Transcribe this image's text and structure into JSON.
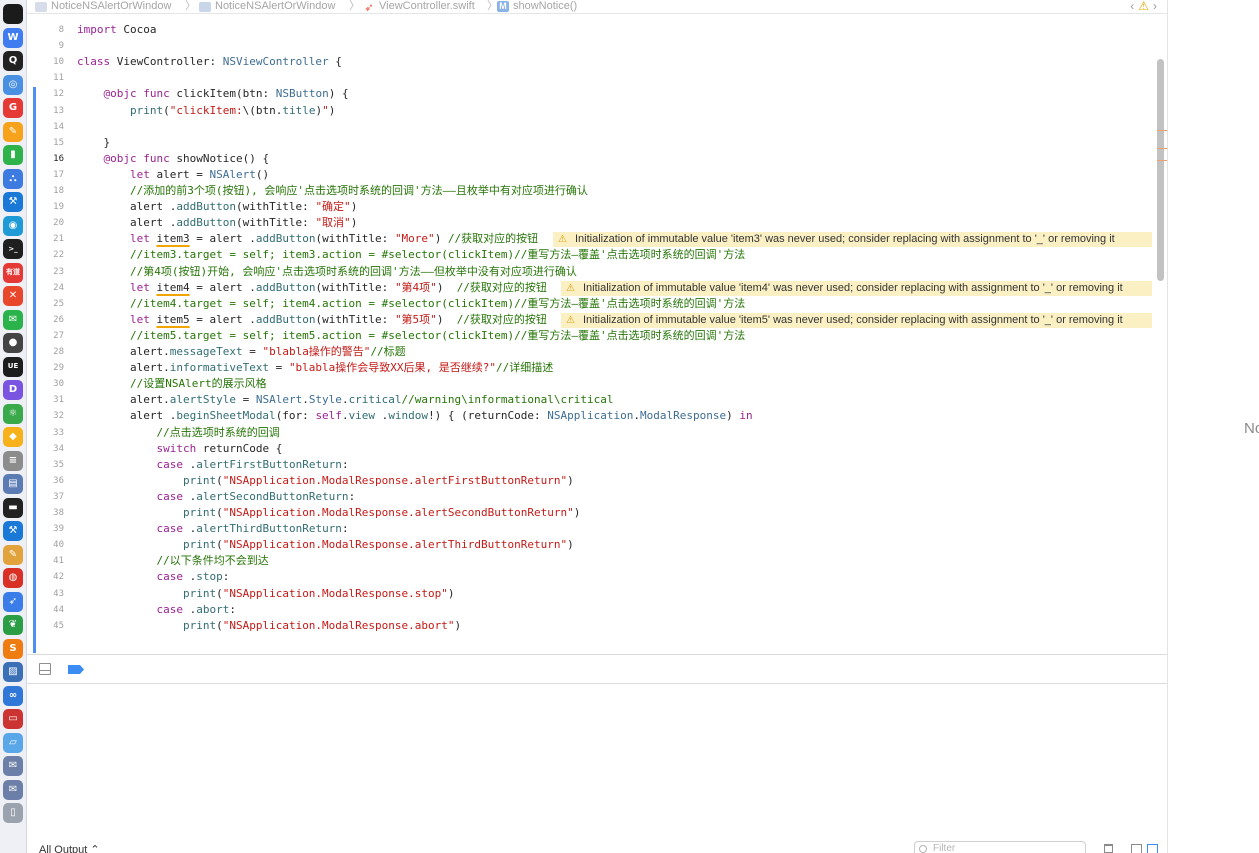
{
  "jumpbar": {
    "crumbs": [
      "NoticeNSAlertOrWindow",
      "NoticeNSAlertOrWindow",
      "ViewController.swift",
      "showNotice()"
    ],
    "separator": "〉",
    "nav_back": "‹",
    "nav_forward": "›",
    "warning_nav": "⚠"
  },
  "dock": [
    {
      "name": "qq-icon",
      "glyph": "",
      "color": "#1b1b1b"
    },
    {
      "name": "wps-icon",
      "glyph": "W",
      "color": "#3f7cf0"
    },
    {
      "name": "penguin-icon",
      "glyph": "Q",
      "color": "#222222"
    },
    {
      "name": "browser-icon",
      "glyph": "◎",
      "color": "#4a90e2"
    },
    {
      "name": "google-icon",
      "glyph": "G",
      "color": "#e53935"
    },
    {
      "name": "quill-icon",
      "glyph": "✎",
      "color": "#f7a21b"
    },
    {
      "name": "numbers-icon",
      "glyph": "▮",
      "color": "#2db34a"
    },
    {
      "name": "keynote-icon",
      "glyph": "⛬",
      "color": "#3e7be0"
    },
    {
      "name": "xcode-icon",
      "glyph": "⚒",
      "color": "#1a78d6"
    },
    {
      "name": "instruments-icon",
      "glyph": "◉",
      "color": "#1e9bd7"
    },
    {
      "name": "terminal-icon",
      "glyph": ">_",
      "color": "#1f1f1f"
    },
    {
      "name": "youdao-icon",
      "glyph": "有道",
      "color": "#e53935"
    },
    {
      "name": "xmind-icon",
      "glyph": "✕",
      "color": "#e8472b"
    },
    {
      "name": "wechat-icon",
      "glyph": "✉",
      "color": "#2bb34b"
    },
    {
      "name": "capture-icon",
      "glyph": "●",
      "color": "#444444"
    },
    {
      "name": "ue-icon",
      "glyph": "UE",
      "color": "#1d1d1d"
    },
    {
      "name": "dash-icon",
      "glyph": "D",
      "color": "#7a54e0"
    },
    {
      "name": "atom-icon",
      "glyph": "⚛",
      "color": "#3aa94a"
    },
    {
      "name": "sketch-icon",
      "glyph": "◆",
      "color": "#f7b21b"
    },
    {
      "name": "database-icon",
      "glyph": "≡",
      "color": "#8c8c8c"
    },
    {
      "name": "preview-icon",
      "glyph": "▤",
      "color": "#5b7bb5"
    },
    {
      "name": "activity-icon",
      "glyph": "▬",
      "color": "#222222"
    },
    {
      "name": "xcode2-icon",
      "glyph": "⚒",
      "color": "#1a78d6"
    },
    {
      "name": "notes-icon",
      "glyph": "✎",
      "color": "#e2a23c"
    },
    {
      "name": "chrome-icon",
      "glyph": "◍",
      "color": "#d93025"
    },
    {
      "name": "bird-icon",
      "glyph": "➶",
      "color": "#3b7de8"
    },
    {
      "name": "evernote-icon",
      "glyph": "❦",
      "color": "#2a9d45"
    },
    {
      "name": "sublime-icon",
      "glyph": "S",
      "color": "#ef7c10"
    },
    {
      "name": "gallery-icon",
      "glyph": "▨",
      "color": "#3b6fb6"
    },
    {
      "name": "network-icon",
      "glyph": "∞",
      "color": "#2f78d8"
    },
    {
      "name": "screen-icon",
      "glyph": "▭",
      "color": "#cc3333"
    },
    {
      "name": "finder-icon",
      "glyph": "▱",
      "color": "#59a6e9"
    },
    {
      "name": "mail-icon",
      "glyph": "✉",
      "color": "#6b7fa8"
    },
    {
      "name": "mail2-icon",
      "glyph": "✉",
      "color": "#6b7fa8"
    },
    {
      "name": "trash-dock-icon",
      "glyph": "▯",
      "color": "#9aa3ad"
    }
  ],
  "code": [
    {
      "n": "8",
      "t": [
        [
          "kw",
          "import"
        ],
        [
          "pl",
          " Cocoa"
        ]
      ]
    },
    {
      "n": "9",
      "t": []
    },
    {
      "n": "10",
      "t": [
        [
          "kw",
          "class"
        ],
        [
          "pl",
          " ViewController: "
        ],
        [
          "ty",
          "NSViewController"
        ],
        [
          "pl",
          " {"
        ]
      ]
    },
    {
      "n": "11",
      "t": []
    },
    {
      "n": "12",
      "t": [
        [
          "pl",
          "    "
        ],
        [
          "kw",
          "@objc"
        ],
        [
          "pl",
          " "
        ],
        [
          "kw",
          "func"
        ],
        [
          "pl",
          " clickItem(btn: "
        ],
        [
          "ty",
          "NSButton"
        ],
        [
          "pl",
          ") {"
        ]
      ]
    },
    {
      "n": "13",
      "t": [
        [
          "pl",
          "        "
        ],
        [
          "fn",
          "print"
        ],
        [
          "pl",
          "("
        ],
        [
          "str",
          "\"clickItem:"
        ],
        [
          "pl",
          "\\(btn."
        ],
        [
          "fn",
          "title"
        ],
        [
          "pl",
          ")"
        ],
        [
          "str",
          "\""
        ],
        [
          "pl",
          ")"
        ]
      ]
    },
    {
      "n": "14",
      "t": []
    },
    {
      "n": "15",
      "t": [
        [
          "pl",
          "    }"
        ]
      ]
    },
    {
      "n": "16",
      "cur": true,
      "t": [
        [
          "pl",
          "    "
        ],
        [
          "kw",
          "@objc"
        ],
        [
          "pl",
          " "
        ],
        [
          "kw",
          "func"
        ],
        [
          "pl",
          " showNotice() {"
        ]
      ]
    },
    {
      "n": "17",
      "t": [
        [
          "pl",
          "        "
        ],
        [
          "kw",
          "let"
        ],
        [
          "pl",
          " alert = "
        ],
        [
          "ty",
          "NSAlert"
        ],
        [
          "pl",
          "()"
        ]
      ]
    },
    {
      "n": "18",
      "t": [
        [
          "pl",
          "        "
        ],
        [
          "cm",
          "//添加的前3个项(按钮), 会响应'点击选项时系统的回调'方法——且枚举中有对应项进行确认"
        ]
      ]
    },
    {
      "n": "19",
      "t": [
        [
          "pl",
          "        alert ."
        ],
        [
          "fn",
          "addButton"
        ],
        [
          "pl",
          "(withTitle: "
        ],
        [
          "str",
          "\"确定\""
        ],
        [
          "pl",
          ")"
        ]
      ]
    },
    {
      "n": "20",
      "t": [
        [
          "pl",
          "        alert ."
        ],
        [
          "fn",
          "addButton"
        ],
        [
          "pl",
          "(withTitle: "
        ],
        [
          "str",
          "\"取消\""
        ],
        [
          "pl",
          ")"
        ]
      ]
    },
    {
      "n": "21",
      "warn": "Initialization of immutable value 'item3' was never used; consider replacing with assignment to '_' or removing it",
      "wl": 526,
      "t": [
        [
          "pl",
          "        "
        ],
        [
          "kw",
          "let"
        ],
        [
          "pl",
          " "
        ],
        [
          "wu",
          "item3"
        ],
        [
          "pl",
          " = alert ."
        ],
        [
          "fn",
          "addButton"
        ],
        [
          "pl",
          "(withTitle: "
        ],
        [
          "str",
          "\"More\""
        ],
        [
          "pl",
          ") "
        ],
        [
          "cm",
          "//获取对应的按钮"
        ]
      ]
    },
    {
      "n": "22",
      "t": [
        [
          "pl",
          "        "
        ],
        [
          "cm",
          "//item3.target = self; item3.action = #selector(clickItem)//重写方法—覆盖'点击选项时系统的回调'方法"
        ]
      ]
    },
    {
      "n": "23",
      "t": [
        [
          "pl",
          "        "
        ],
        [
          "cm",
          "//第4项(按钮)开始, 会响应'点击选项时系统的回调'方法——但枚举中没有对应项进行确认"
        ]
      ]
    },
    {
      "n": "24",
      "warn": "Initialization of immutable value 'item4' was never used; consider replacing with assignment to '_' or removing it",
      "wl": 534,
      "t": [
        [
          "pl",
          "        "
        ],
        [
          "kw",
          "let"
        ],
        [
          "pl",
          " "
        ],
        [
          "wu",
          "item4"
        ],
        [
          "pl",
          " = alert ."
        ],
        [
          "fn",
          "addButton"
        ],
        [
          "pl",
          "(withTitle: "
        ],
        [
          "str",
          "\"第4项\""
        ],
        [
          "pl",
          ")  "
        ],
        [
          "cm",
          "//获取对应的按钮"
        ]
      ]
    },
    {
      "n": "25",
      "t": [
        [
          "pl",
          "        "
        ],
        [
          "cm",
          "//item4.target = self; item4.action = #selector(clickItem)//重写方法—覆盖'点击选项时系统的回调'方法"
        ]
      ]
    },
    {
      "n": "26",
      "warn": "Initialization of immutable value 'item5' was never used; consider replacing with assignment to '_' or removing it",
      "wl": 534,
      "t": [
        [
          "pl",
          "        "
        ],
        [
          "kw",
          "let"
        ],
        [
          "pl",
          " "
        ],
        [
          "wu",
          "item5"
        ],
        [
          "pl",
          " = alert ."
        ],
        [
          "fn",
          "addButton"
        ],
        [
          "pl",
          "(withTitle: "
        ],
        [
          "str",
          "\"第5项\""
        ],
        [
          "pl",
          ")  "
        ],
        [
          "cm",
          "//获取对应的按钮"
        ]
      ]
    },
    {
      "n": "27",
      "t": [
        [
          "pl",
          "        "
        ],
        [
          "cm",
          "//item5.target = self; item5.action = #selector(clickItem)//重写方法—覆盖'点击选项时系统的回调'方法"
        ]
      ]
    },
    {
      "n": "28",
      "t": [
        [
          "pl",
          "        alert."
        ],
        [
          "fn",
          "messageText"
        ],
        [
          "pl",
          " = "
        ],
        [
          "str",
          "\"blabla操作的警告\""
        ],
        [
          "cm",
          "//标题"
        ]
      ]
    },
    {
      "n": "29",
      "t": [
        [
          "pl",
          "        alert."
        ],
        [
          "fn",
          "informativeText"
        ],
        [
          "pl",
          " = "
        ],
        [
          "str",
          "\"blabla操作会导致XX后果, 是否继续?\""
        ],
        [
          "cm",
          "//详细描述"
        ]
      ]
    },
    {
      "n": "30",
      "t": [
        [
          "pl",
          "        "
        ],
        [
          "cm",
          "//设置NSAlert的展示风格"
        ]
      ]
    },
    {
      "n": "31",
      "t": [
        [
          "pl",
          "        alert."
        ],
        [
          "fn",
          "alertStyle"
        ],
        [
          "pl",
          " = "
        ],
        [
          "ty",
          "NSAlert"
        ],
        [
          "pl",
          "."
        ],
        [
          "ty",
          "Style"
        ],
        [
          "pl",
          "."
        ],
        [
          "fn",
          "critical"
        ],
        [
          "cm",
          "//warning\\informational\\critical"
        ]
      ]
    },
    {
      "n": "32",
      "t": [
        [
          "pl",
          "        alert ."
        ],
        [
          "fn",
          "beginSheetModal"
        ],
        [
          "pl",
          "(for: "
        ],
        [
          "kw",
          "self"
        ],
        [
          "pl",
          "."
        ],
        [
          "fn",
          "view"
        ],
        [
          "pl",
          " ."
        ],
        [
          "fn",
          "window"
        ],
        [
          "pl",
          "!) { (returnCode: "
        ],
        [
          "ty",
          "NSApplication"
        ],
        [
          "pl",
          "."
        ],
        [
          "ty",
          "ModalResponse"
        ],
        [
          "pl",
          ") "
        ],
        [
          "kw",
          "in"
        ]
      ]
    },
    {
      "n": "33",
      "t": [
        [
          "pl",
          "            "
        ],
        [
          "cm",
          "//点击选项时系统的回调"
        ]
      ]
    },
    {
      "n": "34",
      "t": [
        [
          "pl",
          "            "
        ],
        [
          "kw",
          "switch"
        ],
        [
          "pl",
          " returnCode {"
        ]
      ]
    },
    {
      "n": "35",
      "t": [
        [
          "pl",
          "            "
        ],
        [
          "kw",
          "case"
        ],
        [
          "pl",
          " ."
        ],
        [
          "fn",
          "alertFirstButtonReturn"
        ],
        [
          "pl",
          ":"
        ]
      ]
    },
    {
      "n": "36",
      "t": [
        [
          "pl",
          "                "
        ],
        [
          "fn",
          "print"
        ],
        [
          "pl",
          "("
        ],
        [
          "str",
          "\"NSApplication.ModalResponse.alertFirstButtonReturn\""
        ],
        [
          "pl",
          ")"
        ]
      ]
    },
    {
      "n": "37",
      "t": [
        [
          "pl",
          "            "
        ],
        [
          "kw",
          "case"
        ],
        [
          "pl",
          " ."
        ],
        [
          "fn",
          "alertSecondButtonReturn"
        ],
        [
          "pl",
          ":"
        ]
      ]
    },
    {
      "n": "38",
      "t": [
        [
          "pl",
          "                "
        ],
        [
          "fn",
          "print"
        ],
        [
          "pl",
          "("
        ],
        [
          "str",
          "\"NSApplication.ModalResponse.alertSecondButtonReturn\""
        ],
        [
          "pl",
          ")"
        ]
      ]
    },
    {
      "n": "39",
      "t": [
        [
          "pl",
          "            "
        ],
        [
          "kw",
          "case"
        ],
        [
          "pl",
          " ."
        ],
        [
          "fn",
          "alertThirdButtonReturn"
        ],
        [
          "pl",
          ":"
        ]
      ]
    },
    {
      "n": "40",
      "t": [
        [
          "pl",
          "                "
        ],
        [
          "fn",
          "print"
        ],
        [
          "pl",
          "("
        ],
        [
          "str",
          "\"NSApplication.ModalResponse.alertThirdButtonReturn\""
        ],
        [
          "pl",
          ")"
        ]
      ]
    },
    {
      "n": "41",
      "t": [
        [
          "pl",
          "            "
        ],
        [
          "cm",
          "//以下条件均不会到达"
        ]
      ]
    },
    {
      "n": "42",
      "t": [
        [
          "pl",
          "            "
        ],
        [
          "kw",
          "case"
        ],
        [
          "pl",
          " ."
        ],
        [
          "fn",
          "stop"
        ],
        [
          "pl",
          ":"
        ]
      ]
    },
    {
      "n": "43",
      "t": [
        [
          "pl",
          "                "
        ],
        [
          "fn",
          "print"
        ],
        [
          "pl",
          "("
        ],
        [
          "str",
          "\"NSApplication.ModalResponse.stop\""
        ],
        [
          "pl",
          ")"
        ]
      ]
    },
    {
      "n": "44",
      "t": [
        [
          "pl",
          "            "
        ],
        [
          "kw",
          "case"
        ],
        [
          "pl",
          " ."
        ],
        [
          "fn",
          "abort"
        ],
        [
          "pl",
          ":"
        ]
      ]
    },
    {
      "n": "45",
      "t": [
        [
          "pl",
          "                "
        ],
        [
          "fn",
          "print"
        ],
        [
          "pl",
          "("
        ],
        [
          "str",
          "\"NSApplication.ModalResponse.abort\""
        ],
        [
          "pl",
          ")"
        ]
      ]
    }
  ],
  "output": {
    "scope_label": "All Output ⌃",
    "filter_placeholder": "Filter"
  },
  "right_panel": {
    "clipped_text": "No"
  }
}
